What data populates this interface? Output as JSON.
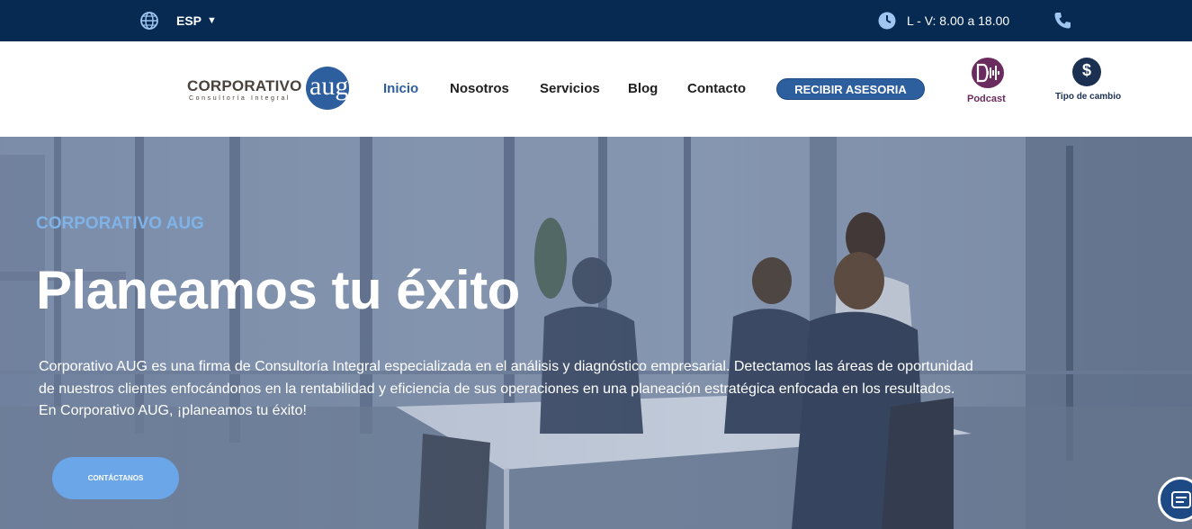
{
  "topbar": {
    "language": "ESP",
    "hours": "L - V: 8.00 a 18.00",
    "icons": [
      "globe-icon",
      "caret-down-icon",
      "clock-icon",
      "phone-icon"
    ]
  },
  "header": {
    "logo": {
      "wordmark": "CORPORATIVO",
      "tagline": "Consultoría Integral",
      "monogram": "aug"
    },
    "nav": [
      {
        "label": "Inicio",
        "active": true
      },
      {
        "label": "Nosotros",
        "active": false
      },
      {
        "label": "Servicios",
        "active": false
      },
      {
        "label": "Blog",
        "active": false
      },
      {
        "label": "Contacto",
        "active": false
      }
    ],
    "cta": "RECIBIR ASESORIA",
    "podcast_label": "Podcast",
    "exchange_label": "Tipo de cambio",
    "exchange_symbol": "$"
  },
  "hero": {
    "eyebrow": "CORPORATIVO AUG",
    "title": "Planeamos tu éxito",
    "body": "Corporativo AUG es una firma de Consultoría Integral especializada en el análisis y diagnóstico empresarial. Detectamos las áreas de oportunidad de nuestros clientes enfocándonos en la rentabilidad y eficiencia de sus operaciones en una planeación estratégica enfocada en los resultados. En Corporativo AUG, ¡planeamos tu éxito!",
    "button": "CONTÁCTANOS"
  },
  "colors": {
    "topbar": "#062a52",
    "accent": "#2d5e9e",
    "eyebrow": "#7fb3e8",
    "button": "#6aa6e8",
    "podcast": "#6a2c5e"
  }
}
